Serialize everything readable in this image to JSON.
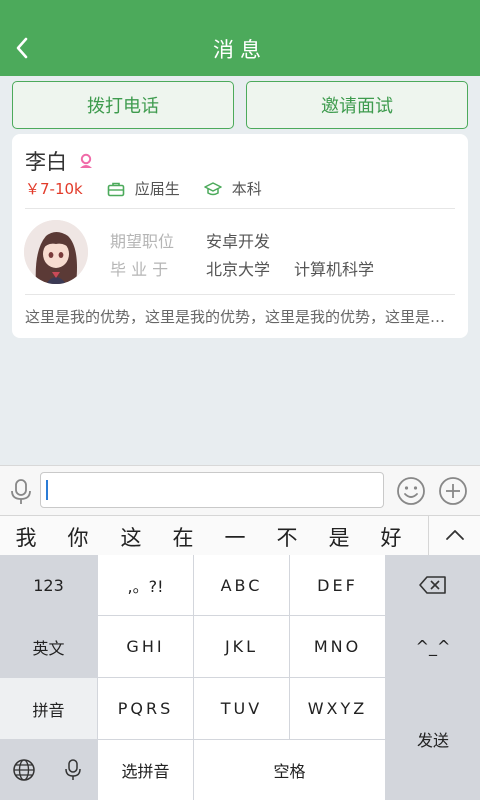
{
  "header": {
    "title": "消息",
    "back_icon": "back-chevron-icon"
  },
  "actions": {
    "call_label": "拨打电话",
    "invite_label": "邀请面试"
  },
  "candidate": {
    "name": "李白",
    "gender_icon": "female-icon",
    "salary": "￥7-10k",
    "status": "应届生",
    "degree": "本科",
    "expected_position_label": "期望职位",
    "expected_position": "安卓开发",
    "graduated_label": "毕 业 于",
    "school": "北京大学",
    "major": "计算机科学",
    "advantage": "这里是我的优势，这里是我的优势，这里是我的优势，这里是我的优势"
  },
  "input": {
    "value": "",
    "placeholder": ""
  },
  "candidates_bar": {
    "words": [
      "我",
      "你",
      "这",
      "在",
      "一",
      "不",
      "是",
      "好"
    ]
  },
  "keyboard": {
    "k123": "123",
    "punct": ",。?!",
    "abc": "ABC",
    "def": "DEF",
    "english": "英文",
    "ghi": "GHI",
    "jkl": "JKL",
    "mno": "MNO",
    "face": "^_^",
    "pinyin": "拼音",
    "pqrs": "PQRS",
    "tuv": "TUV",
    "wxyz": "WXYZ",
    "send": "发送",
    "select_pinyin": "选拼音",
    "space": "空格"
  },
  "colors": {
    "brand_green": "#4caa5b",
    "salary_red": "#e23b2a"
  }
}
